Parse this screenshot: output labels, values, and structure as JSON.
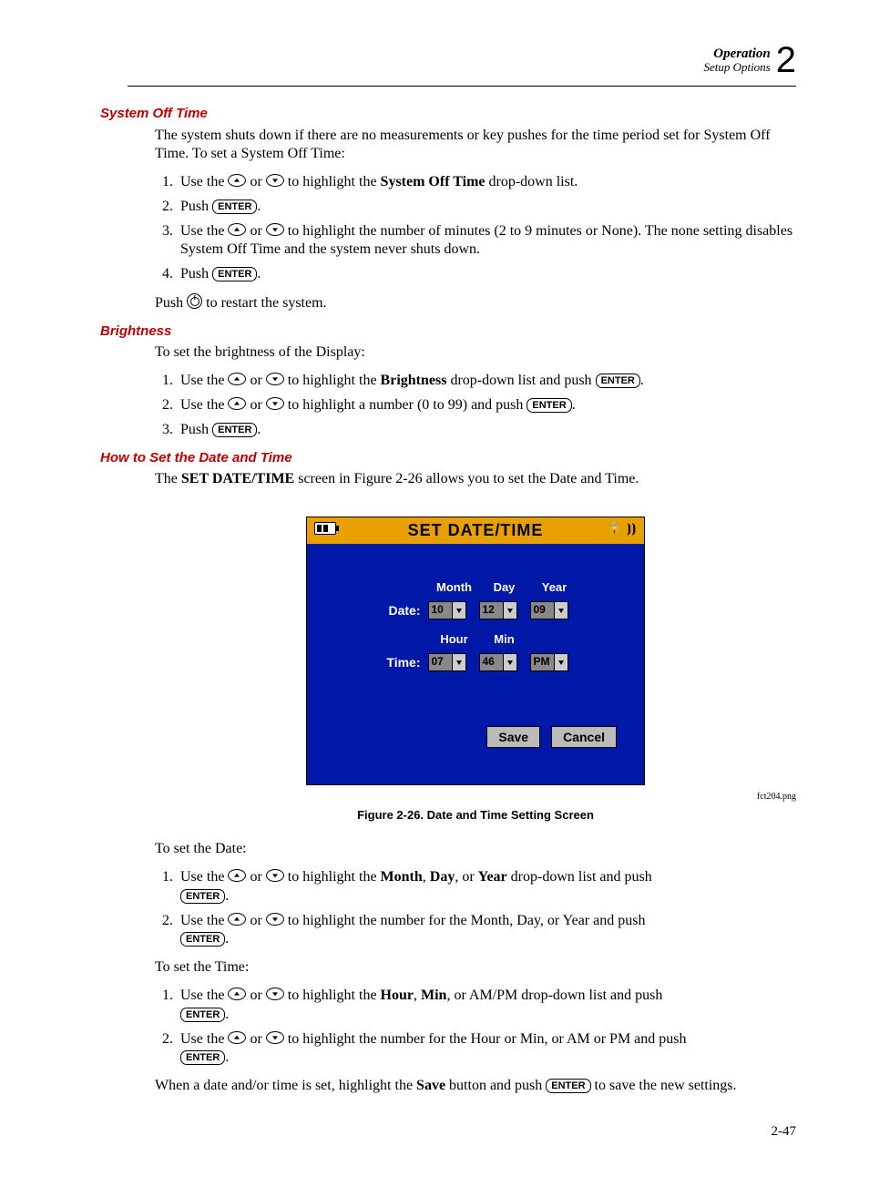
{
  "header": {
    "line1": "Operation",
    "line2": "Setup Options",
    "chapter": "2"
  },
  "keys": {
    "enter": "ENTER"
  },
  "sec1": {
    "title": "System Off Time",
    "intro": "The system shuts down if there are no measurements or key pushes for the time period set for System Off Time. To set a System Off Time:",
    "s1a": "Use the ",
    "s1b": " or ",
    "s1c": " to highlight the ",
    "s1bold": "System Off Time",
    "s1d": " drop-down list.",
    "s2a": "Push ",
    "s3a": "Use the ",
    "s3b": " or ",
    "s3c": " to highlight the number of minutes (2 to 9 minutes or None). The none setting disables System Off Time and the system never shuts down.",
    "s4a": "Push ",
    "restartA": "Push ",
    "restartB": " to restart the system."
  },
  "sec2": {
    "title": "Brightness",
    "intro": "To set the brightness of the Display:",
    "s1a": "Use the ",
    "s1b": " or ",
    "s1c": " to highlight the ",
    "s1bold": "Brightness",
    "s1d": " drop-down list and push ",
    "s2a": "Use the ",
    "s2b": " or ",
    "s2c": " to highlight a number (0 to 99) and push ",
    "s3a": "Push "
  },
  "sec3": {
    "title": "How to Set the Date and Time",
    "introA": "The ",
    "introBold": "SET DATE/TIME",
    "introB": " screen in Figure 2-26 allows you to set the Date and Time."
  },
  "device": {
    "title": "SET DATE/TIME",
    "monthLbl": "Month",
    "dayLbl": "Day",
    "yearLbl": "Year",
    "dateLbl": "Date:",
    "month": "10",
    "day": "12",
    "year": "09",
    "hourLbl": "Hour",
    "minLbl": "Min",
    "timeLbl": "Time:",
    "hour": "07",
    "min": "46",
    "ampm": "PM",
    "save": "Save",
    "cancel": "Cancel",
    "file": "fct204.png",
    "caption": "Figure 2-26. Date and Time Setting Screen"
  },
  "sec4": {
    "dateIntro": "To set the Date:",
    "d1a": "Use the ",
    "d1b": " or ",
    "d1c": " to highlight the ",
    "d1m": "Month",
    "d1comma": ", ",
    "d1d": "Day",
    "d1or": ", or ",
    "d1y": "Year",
    "d1end": " drop-down list and push ",
    "d2a": "Use the ",
    "d2b": " or ",
    "d2c": " to highlight the number for the Month, Day, or Year and push ",
    "timeIntro": "To set the Time:",
    "t1a": "Use the ",
    "t1b": " or ",
    "t1c": " to highlight the ",
    "t1h": "Hour",
    "t1comma": ", ",
    "t1m": "Min",
    "t1end": ", or AM/PM drop-down list and push ",
    "t2a": "Use the ",
    "t2b": " or ",
    "t2c": " to highlight the number for the Hour or Min, or AM or PM and push ",
    "finalA": "When a date and/or time is set, highlight the ",
    "finalBold": "Save",
    "finalB": " button and push ",
    "finalC": " to save the new settings."
  },
  "pageNum": "2-47"
}
